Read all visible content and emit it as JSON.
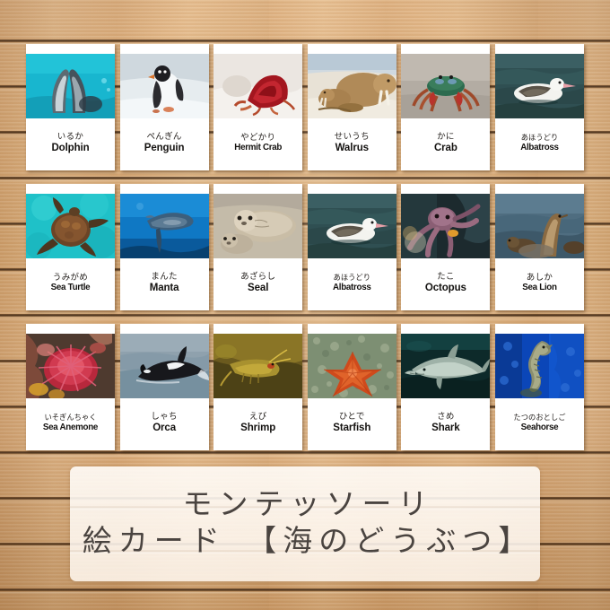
{
  "background": {
    "material": "light-wood-planks",
    "base_color": "#dcb181",
    "seam_color": "#2e1602"
  },
  "title_banner": {
    "line1": "モンテッソーリ",
    "line2": "絵カード　【海のどうぶつ】",
    "text_color": "#4a4440",
    "panel_color": "#fdf7f0"
  },
  "cards": [
    {
      "jp": "いるか",
      "en": "Dolphin",
      "photo": "dolphin",
      "jp_small": false,
      "en_small": false
    },
    {
      "jp": "ぺんぎん",
      "en": "Penguin",
      "photo": "penguin",
      "jp_small": false,
      "en_small": false
    },
    {
      "jp": "やどかり",
      "en": "Hermit Crab",
      "photo": "hermit-crab",
      "jp_small": false,
      "en_small": true
    },
    {
      "jp": "せいうち",
      "en": "Walrus",
      "photo": "walrus",
      "jp_small": false,
      "en_small": false
    },
    {
      "jp": "かに",
      "en": "Crab",
      "photo": "crab",
      "jp_small": false,
      "en_small": false
    },
    {
      "jp": "あほうどり",
      "en": "Albatross",
      "photo": "albatross",
      "jp_small": true,
      "en_small": true
    },
    {
      "jp": "うみがめ",
      "en": "Sea Turtle",
      "photo": "sea-turtle",
      "jp_small": false,
      "en_small": true
    },
    {
      "jp": "まんた",
      "en": "Manta",
      "photo": "manta",
      "jp_small": false,
      "en_small": false
    },
    {
      "jp": "あざらし",
      "en": "Seal",
      "photo": "seal",
      "jp_small": false,
      "en_small": false
    },
    {
      "jp": "あほうどり",
      "en": "Albatross",
      "photo": "albatross",
      "jp_small": true,
      "en_small": true
    },
    {
      "jp": "たこ",
      "en": "Octopus",
      "photo": "octopus",
      "jp_small": false,
      "en_small": false
    },
    {
      "jp": "あしか",
      "en": "Sea Lion",
      "photo": "sea-lion",
      "jp_small": false,
      "en_small": true
    },
    {
      "jp": "いそぎんちゃく",
      "en": "Sea Anemone",
      "photo": "sea-anemone",
      "jp_small": true,
      "en_small": true
    },
    {
      "jp": "しゃち",
      "en": "Orca",
      "photo": "orca",
      "jp_small": false,
      "en_small": false
    },
    {
      "jp": "えび",
      "en": "Shrimp",
      "photo": "shrimp",
      "jp_small": false,
      "en_small": false
    },
    {
      "jp": "ひとで",
      "en": "Starfish",
      "photo": "starfish",
      "jp_small": false,
      "en_small": false
    },
    {
      "jp": "さめ",
      "en": "Shark",
      "photo": "shark",
      "jp_small": false,
      "en_small": false
    },
    {
      "jp": "たつのおとしご",
      "en": "Seahorse",
      "photo": "seahorse",
      "jp_small": true,
      "en_small": true
    }
  ]
}
